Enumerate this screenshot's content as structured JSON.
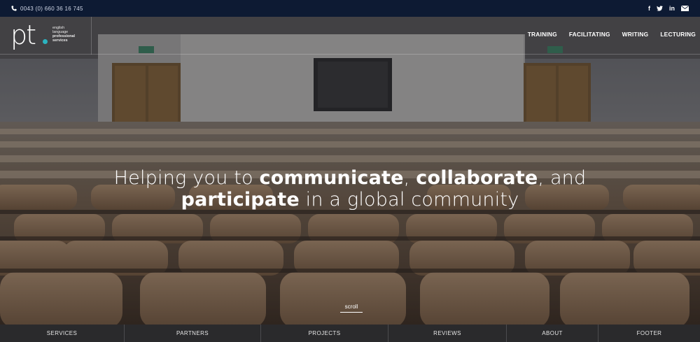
{
  "topbar": {
    "phone": "0043 (0) 660 36 16 745",
    "social_icons": [
      "facebook-icon",
      "twitter-icon",
      "linkedin-icon",
      "email-icon"
    ]
  },
  "logo": {
    "mark": "pt",
    "lines": [
      "english",
      "language",
      "professional",
      "services"
    ],
    "accent_color": "#2bb3c0"
  },
  "nav": {
    "items": [
      "TRAINING",
      "FACILITATING",
      "WRITING",
      "LECTURING"
    ]
  },
  "hero": {
    "line1_pre": "Helping you to ",
    "line1_b1": "communicate",
    "line1_mid": ", ",
    "line1_b2": "collaborate",
    "line1_post": ", and",
    "line2_b": "participate",
    "line2_post": " in a global community",
    "scroll_label": "scroll"
  },
  "bottom_nav": {
    "items": [
      "SERVICES",
      "PARTNERS",
      "PROJECTS",
      "REVIEWS",
      "ABOUT",
      "FOOTER"
    ]
  }
}
